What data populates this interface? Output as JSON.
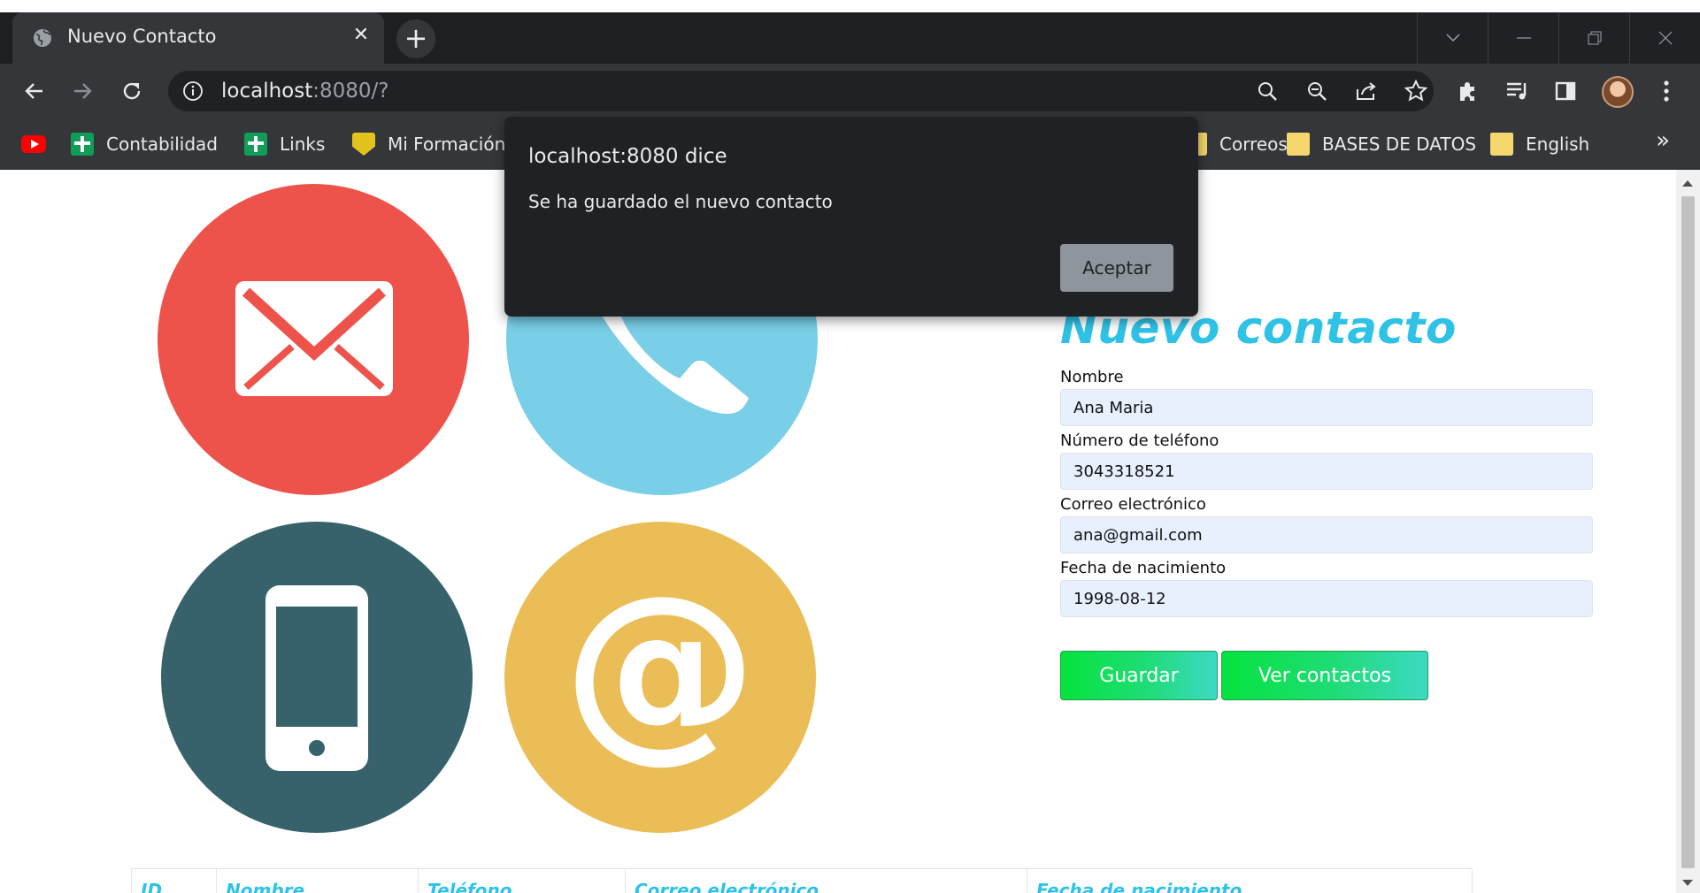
{
  "browser": {
    "tab_title": "Nuevo Contacto",
    "url_host": "localhost",
    "url_rest": ":8080/?",
    "bookmarks": [
      {
        "label": "",
        "icon": "youtube-icon"
      },
      {
        "label": "Contabilidad",
        "icon": "sheets-icon"
      },
      {
        "label": "Links",
        "icon": "sheets-icon"
      },
      {
        "label": "Mi Formación",
        "icon": "shield-icon"
      },
      {
        "label": "Correos",
        "icon": "folder-icon"
      },
      {
        "label": "BASES DE DATOS",
        "icon": "folder-icon"
      },
      {
        "label": "English",
        "icon": "folder-icon"
      }
    ],
    "more_bookmarks": "»"
  },
  "dialog": {
    "title": "localhost:8080 dice",
    "message": "Se ha guardado el nuevo contacto",
    "ok_label": "Aceptar"
  },
  "form": {
    "title": "Nuevo contacto",
    "fields": [
      {
        "label": "Nombre",
        "value": "Ana Maria"
      },
      {
        "label": "Número de teléfono",
        "value": "3043318521"
      },
      {
        "label": "Correo electrónico",
        "value": "ana@gmail.com"
      },
      {
        "label": "Fecha de nacimiento",
        "value": "1998-08-12"
      }
    ],
    "save_label": "Guardar",
    "view_label": "Ver contactos"
  },
  "table": {
    "headers": [
      "ID",
      "Nombre",
      "Teléfono",
      "Correo electrónico",
      "Fecha de nacimiento"
    ]
  },
  "colors": {
    "accent": "#2ec2e6",
    "button_gradient_start": "#05e33e",
    "button_gradient_end": "#3dd9c4",
    "dialog_bg": "#202124"
  }
}
